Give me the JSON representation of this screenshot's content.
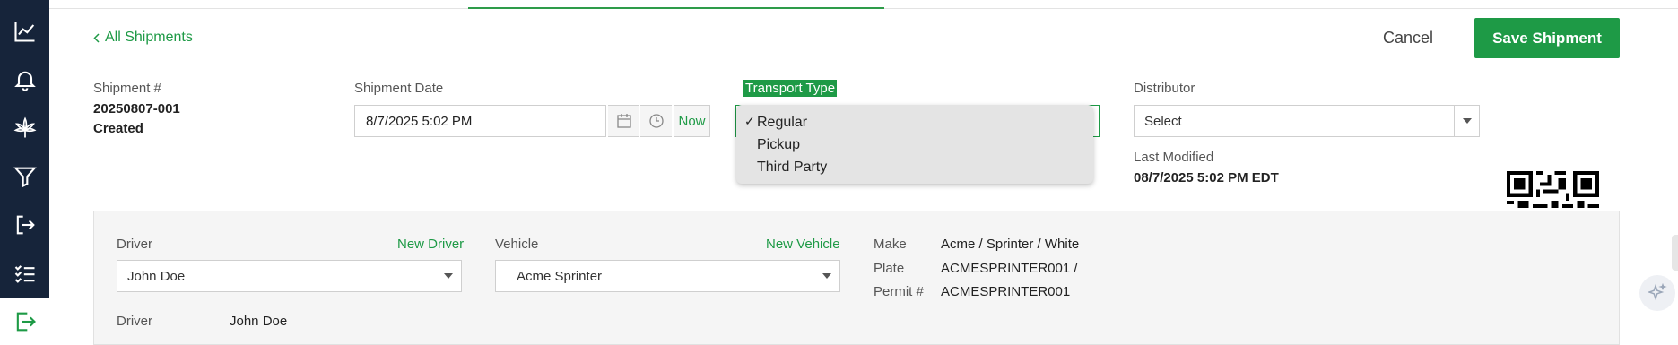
{
  "nav": {
    "back_link": "All Shipments",
    "cancel_label": "Cancel",
    "save_label": "Save Shipment"
  },
  "shipment": {
    "number_label": "Shipment #",
    "number_value": "20250807-001",
    "status": "Created",
    "date_label": "Shipment Date",
    "date_value": "8/7/2025 5:02 PM",
    "now_label": "Now"
  },
  "transport": {
    "label": "Transport Type",
    "options": [
      "Regular",
      "Pickup",
      "Third Party"
    ],
    "selected": "Regular",
    "check_mark": "✓"
  },
  "distributor": {
    "label": "Distributor",
    "placeholder": "Select",
    "last_modified_label": "Last Modified",
    "last_modified_value": "08/7/2025 5:02 PM EDT"
  },
  "driver": {
    "label": "Driver",
    "new_link": "New Driver",
    "selected": "John Doe",
    "detail_label": "Driver",
    "detail_value": "John Doe"
  },
  "vehicle": {
    "label": "Vehicle",
    "new_link": "New Vehicle",
    "selected": "Acme Sprinter",
    "make_label": "Make",
    "make_value": "Acme / Sprinter / White",
    "plate_label": "Plate",
    "plate_value": "ACMESPRINTER001 /",
    "permit_label": "Permit #",
    "permit_value": "ACMESPRINTER001"
  },
  "sidebar_icons": [
    "chart-line-icon",
    "bell-icon",
    "cannabis-leaf-icon",
    "filter-icon",
    "sign-in-icon",
    "checklist-icon",
    "sign-out-icon"
  ],
  "colors": {
    "accent": "#1e9a46",
    "sidebar_bg": "#16243a"
  }
}
